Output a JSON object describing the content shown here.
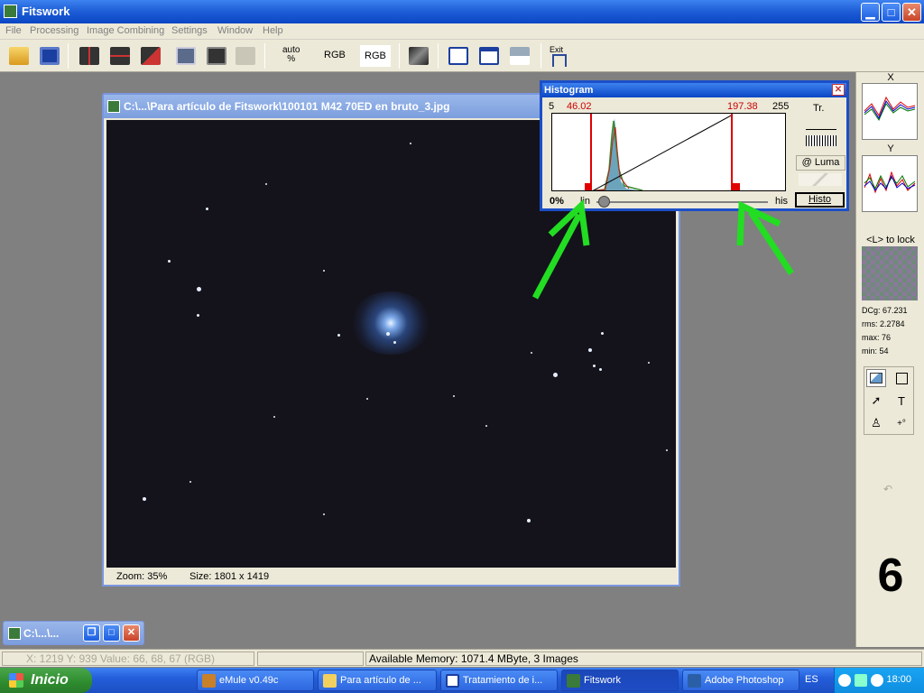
{
  "app": {
    "title": "Fitswork"
  },
  "menu": [
    "File",
    "Processing",
    "Image Combining",
    "Settings",
    "Window",
    "Help"
  ],
  "toolbar": {
    "auto_line1": "auto",
    "auto_line2": "%",
    "rgb1": "RGB",
    "rgb2": "RGB",
    "exit": "Exit"
  },
  "image_window": {
    "title": "C:\\...\\Para artículo de Fitswork\\100101 M42 70ED en bruto_3.jpg",
    "zoom": "Zoom: 35%",
    "size": "Size: 1801 x 1419"
  },
  "histogram": {
    "title": "Histogram",
    "axis_min": "5",
    "low_value": "46.02",
    "high_value": "197.38",
    "axis_max": "255",
    "percent": "0%",
    "lin": "lin",
    "his": "his",
    "tr": "Tr.",
    "luma": "@ Luma",
    "histo_button": "Histo"
  },
  "side_panel": {
    "x_label": "X",
    "y_label": "Y",
    "lock_hint": "<L> to lock",
    "dcg": "DCg: 67.231",
    "rms": "rms: 2.2784",
    "max": "max: 76",
    "min": "min: 54",
    "big_number": "6"
  },
  "minimized_window": {
    "title": "C:\\...\\..."
  },
  "status": {
    "coords": "X: 1219  Y: 939  Value: 66, 68, 67 (RGB)",
    "memory": "Available Memory: 1071.4 MByte, 3 Images"
  },
  "taskbar": {
    "start": "Inicio",
    "tasks": [
      "eMule v0.49c",
      "Para artículo de ...",
      "Tratamiento de i...",
      "Fitswork",
      "Adobe Photoshop"
    ],
    "lang": "ES",
    "clock": "18:00"
  },
  "colors": {
    "title_blue": "#0a46c4",
    "arrow_green": "#22dd22",
    "marker_red": "#e00000"
  }
}
